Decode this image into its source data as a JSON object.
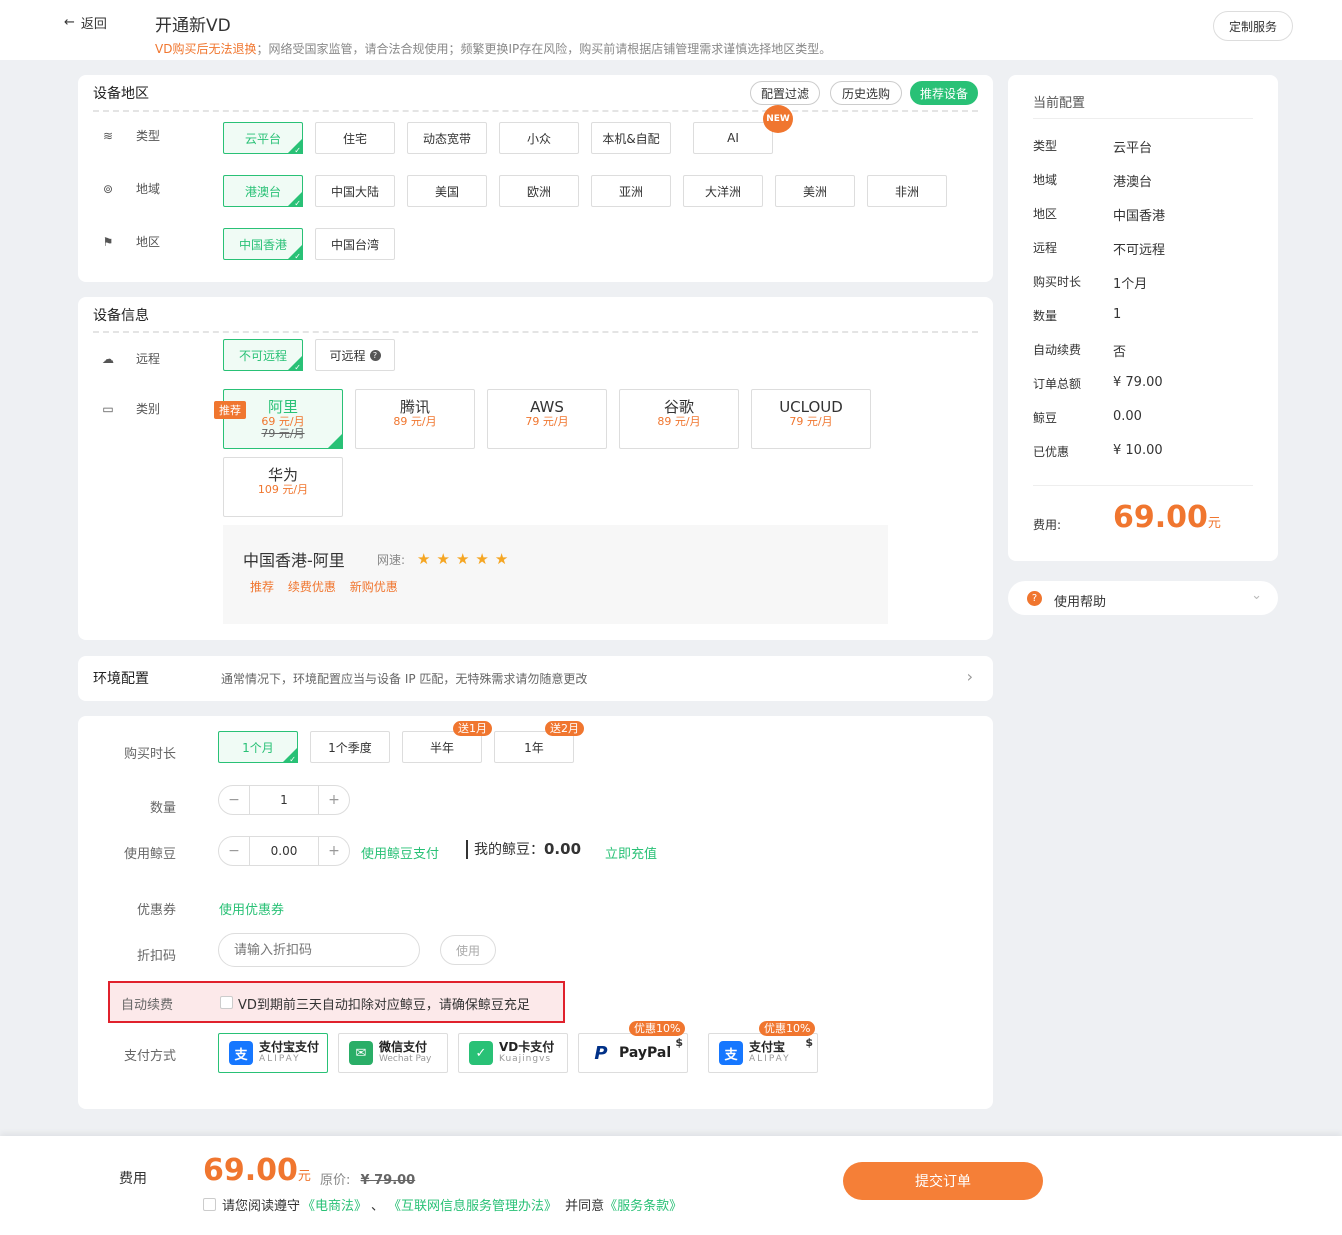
{
  "header": {
    "back_label": "返回",
    "title": "开通新VD",
    "notice_warn": "VD购买后无法退换",
    "notice_rest": "；网络受国家监管，请合法合规使用；频繁更换IP存在风险，购买前请根据店铺管理需求谨慎选择地区类型。",
    "custom_service": "定制服务"
  },
  "region_card": {
    "title": "设备地区",
    "pills": [
      "配置过滤",
      "历史选购",
      "推荐设备"
    ],
    "type_label": "类型",
    "types": [
      "云平台",
      "住宅",
      "动态宽带",
      "小众",
      "本机&自配",
      "AI"
    ],
    "new_badge": "NEW",
    "area_label": "地域",
    "areas": [
      "港澳台",
      "中国大陆",
      "美国",
      "欧洲",
      "亚洲",
      "大洋洲",
      "美洲",
      "非洲"
    ],
    "region_label": "地区",
    "regions": [
      "中国香港",
      "中国台湾"
    ]
  },
  "device_card": {
    "title": "设备信息",
    "remote_label": "远程",
    "remote_options": [
      "不可远程",
      "可远程"
    ],
    "category_label": "类别",
    "recommend_tag": "推荐",
    "clouds": [
      {
        "name": "阿里",
        "price": "69 元/月",
        "old": "79 元/月"
      },
      {
        "name": "腾讯",
        "price": "89 元/月"
      },
      {
        "name": "AWS",
        "price": "79 元/月"
      },
      {
        "name": "谷歌",
        "price": "89 元/月"
      },
      {
        "name": "UCLOUD",
        "price": "79 元/月"
      },
      {
        "name": "华为",
        "price": "109 元/月"
      }
    ],
    "detail_title": "中国香港-阿里",
    "speed_label": "网速:",
    "speed_stars": 5,
    "detail_tags": [
      "推荐",
      "续费优惠",
      "新购优惠"
    ]
  },
  "env_card": {
    "title": "环境配置",
    "desc": "通常情况下，环境配置应当与设备 IP 匹配，无特殊需求请勿随意更改"
  },
  "purchase": {
    "duration_label": "购买时长",
    "durations": [
      "1个月",
      "1个季度",
      "半年",
      "1年"
    ],
    "duration_badges": {
      "half": "送1月",
      "year": "送2月"
    },
    "quantity_label": "数量",
    "quantity": "1",
    "beans_label": "使用鲸豆",
    "beans_value": "0.00",
    "use_beans_link": "使用鲸豆支付",
    "my_beans_label": "我的鲸豆：",
    "my_beans_value": "0.00",
    "recharge_link": "立即充值",
    "coupon_label": "优惠券",
    "coupon_link": "使用优惠券",
    "discount_label": "折扣码",
    "discount_placeholder": "请输入折扣码",
    "discount_use": "使用",
    "auto_renew_label": "自动续费",
    "auto_renew_text": "VD到期前三天自动扣除对应鲸豆，请确保鲸豆充足",
    "pay_label": "支付方式",
    "pay_methods": [
      {
        "t1": "支付宝支付",
        "t2": "ALIPAY"
      },
      {
        "t1": "微信支付",
        "t2": "Wechat Pay"
      },
      {
        "t1": "VD卡支付",
        "t2": "Kuajingvs"
      },
      {
        "t1": "PayPal",
        "t2": "",
        "badge": "优惠10%"
      },
      {
        "t1": "支付宝",
        "t2": "ALIPAY",
        "badge": "优惠10%"
      }
    ]
  },
  "summary": {
    "title": "当前配置",
    "rows": [
      {
        "k": "类型",
        "v": "云平台"
      },
      {
        "k": "地域",
        "v": "港澳台"
      },
      {
        "k": "地区",
        "v": "中国香港"
      },
      {
        "k": "远程",
        "v": "不可远程"
      },
      {
        "k": "购买时长",
        "v": "1个月"
      },
      {
        "k": "数量",
        "v": "1"
      },
      {
        "k": "自动续费",
        "v": "否"
      },
      {
        "k": "订单总额",
        "v": "¥ 79.00"
      },
      {
        "k": "鲸豆",
        "v": "0.00"
      },
      {
        "k": "已优惠",
        "v": "¥ 10.00"
      }
    ],
    "fee_label": "费用:",
    "fee_value": "69.00",
    "fee_unit": "元",
    "help_label": "使用帮助"
  },
  "footer": {
    "fee_label": "费用",
    "fee_value": "69.00",
    "fee_unit": "元",
    "orig_label": "原价:",
    "orig_value": "¥ 79.00",
    "agree_prefix": "请您阅读遵守",
    "law1": "《电商法》",
    "sep": "、",
    "law2": "《互联网信息服务管理办法》",
    "agree_mid": "并同意",
    "law3": "《服务条款》",
    "submit": "提交订单"
  },
  "colors": {
    "accent": "#29c176",
    "orange": "#f0762f",
    "highlight": "#e0212c"
  }
}
